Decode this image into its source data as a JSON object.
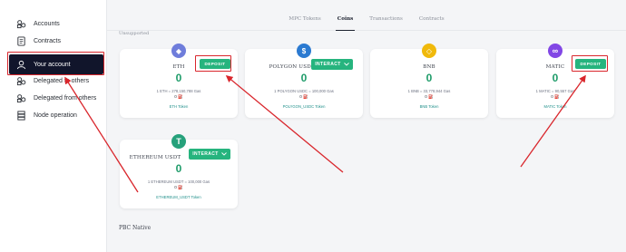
{
  "sidebar": {
    "items": [
      {
        "label": "Accounts",
        "icon": "accounts-icon"
      },
      {
        "label": "Contracts",
        "icon": "contracts-icon"
      },
      {
        "label": "Your account",
        "icon": "user-icon"
      },
      {
        "label": "Delegated to others",
        "icon": "delegated-to-icon"
      },
      {
        "label": "Delegated from others",
        "icon": "delegated-from-icon"
      },
      {
        "label": "Node operation",
        "icon": "server-icon"
      }
    ],
    "active_index": 2
  },
  "tabs": [
    "MPC Tokens",
    "Coins",
    "Transactions",
    "Contracts"
  ],
  "active_tab": "Coins",
  "cut_heading": "Unsupported",
  "coins": [
    {
      "name": "ETH",
      "balance": "0",
      "rate": "1 ETH = 278,150,788 Gas",
      "extra": "0 ⛽",
      "token": "ETH Token",
      "button": "DEPOSIT",
      "logo_color": "#6f7ddb",
      "logo_symbol": "◆"
    },
    {
      "name": "POLYGON USDC",
      "balance": "0",
      "rate": "1 POLYGON USDC = 100,000 Gas",
      "extra": "0 ⛽",
      "token": "POLYGON_USDC Token",
      "button": "INTERACT",
      "logo_color": "#2b7ad1",
      "logo_symbol": "$"
    },
    {
      "name": "BNB",
      "balance": "0",
      "rate": "1 BNB = 33,778,944 Gas",
      "extra": "0 ⛽",
      "token": "BNB Token",
      "logo_color": "#f0b90b",
      "logo_symbol": "◇"
    },
    {
      "name": "MATIC",
      "balance": "0",
      "rate": "1 MATIC = 90,557 Gas",
      "extra": "0 ⛽",
      "token": "MATIC Token",
      "button": "DEPOSIT",
      "logo_color": "#8247e5",
      "logo_symbol": "∞"
    },
    {
      "name": "ETHEREUM USDT",
      "balance": "0",
      "rate": "1 ETHEREUM USDT = 100,000 Gas",
      "extra": "0 ⛽",
      "token": "ETHEREUM_USDT Token",
      "button": "INTERACT",
      "logo_color": "#26a17b",
      "logo_symbol": "T"
    }
  ],
  "section_label": "PBC Native",
  "colors": {
    "accent": "#26b47e",
    "annotation": "#d9262c",
    "active_nav": "#11152b"
  }
}
